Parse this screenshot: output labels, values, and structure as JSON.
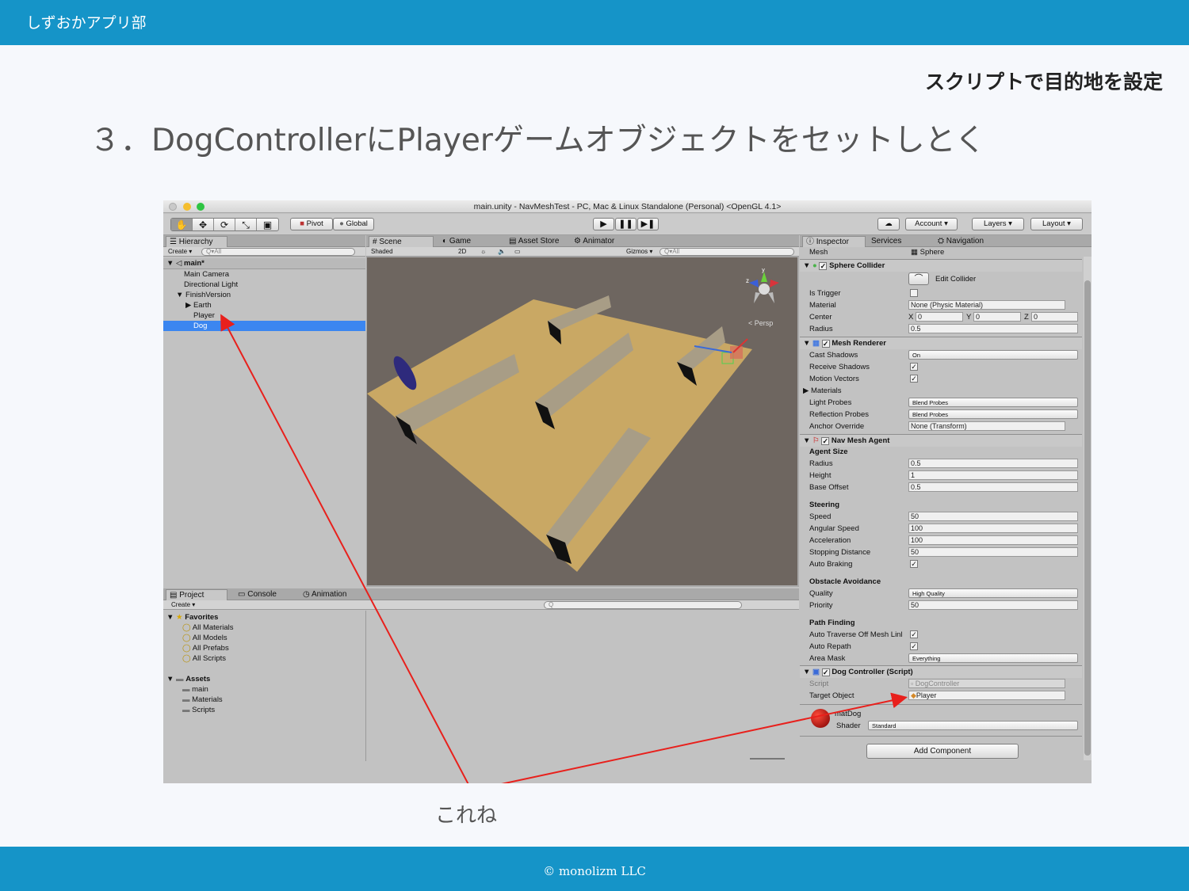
{
  "header": {
    "org": "しずおかアプリ部"
  },
  "footer": {
    "copyright": "© monolizm LLC"
  },
  "slide": {
    "section": "スクリプトで目的地を設定",
    "title": "３．DogControllerにPlayerゲームオブジェクトをセットしとく",
    "note": "これね"
  },
  "colors": {
    "brand": "#1594c8",
    "arrow": "#e8201c",
    "selection": "#3b86f0",
    "ground": "#c9a864"
  },
  "unity": {
    "window_title": "main.unity - NavMeshTest - PC, Mac & Linux Standalone (Personal) <OpenGL 4.1>",
    "toolbar": {
      "tools": [
        "hand-icon",
        "move-icon",
        "rotate-icon",
        "scale-icon",
        "rect-icon"
      ],
      "pivot": "Pivot",
      "global": "Global",
      "play_icons": [
        "play-icon",
        "pause-icon",
        "step-icon"
      ],
      "cloud": "cloud-icon",
      "account": "Account",
      "layers": "Layers",
      "layout": "Layout"
    },
    "hierarchy": {
      "tab": "Hierarchy",
      "create": "Create",
      "search": "Q▾All",
      "scene": "main*",
      "items": [
        "Main Camera",
        "Directional Light",
        "FinishVersion",
        "Earth",
        "Player",
        "Dog"
      ]
    },
    "scene": {
      "tabs": [
        "Scene",
        "Game",
        "Asset Store",
        "Animator"
      ],
      "shaded": "Shaded",
      "mode_2d": "2D",
      "gizmos": "Gizmos",
      "search": "Q▾All",
      "persp": "< Persp"
    },
    "project": {
      "tabs": [
        "Project",
        "Console",
        "Animation"
      ],
      "create": "Create",
      "favorites_label": "Favorites",
      "favorites": [
        "All Materials",
        "All Models",
        "All Prefabs",
        "All Scripts"
      ],
      "assets_label": "Assets",
      "assets": [
        "main",
        "Materials",
        "Scripts"
      ]
    },
    "inspector": {
      "tabs": [
        "Inspector",
        "Services",
        "Navigation"
      ],
      "mesh_label": "Mesh",
      "mesh_value": "Sphere",
      "sphere_collider": {
        "title": "Sphere Collider",
        "edit_collider": "Edit Collider",
        "is_trigger": "Is Trigger",
        "material": "Material",
        "material_value": "None (Physic Material)",
        "center": "Center",
        "x": "0",
        "y": "0",
        "z": "0",
        "radius": "Radius",
        "radius_value": "0.5"
      },
      "mesh_renderer": {
        "title": "Mesh Renderer",
        "cast_shadows": "Cast Shadows",
        "cast_shadows_value": "On",
        "receive_shadows": "Receive Shadows",
        "motion_vectors": "Motion Vectors",
        "materials": "Materials",
        "light_probes": "Light Probes",
        "light_probes_value": "Blend Probes",
        "reflection_probes": "Reflection Probes",
        "reflection_probes_value": "Blend Probes",
        "anchor_override": "Anchor Override",
        "anchor_override_value": "None (Transform)"
      },
      "nav_mesh_agent": {
        "title": "Nav Mesh Agent",
        "agent_size": "Agent Size",
        "radius": "Radius",
        "radius_value": "0.5",
        "height": "Height",
        "height_value": "1",
        "base_offset": "Base Offset",
        "base_offset_value": "0.5",
        "steering": "Steering",
        "speed": "Speed",
        "speed_value": "50",
        "angular_speed": "Angular Speed",
        "angular_speed_value": "100",
        "acceleration": "Acceleration",
        "acceleration_value": "100",
        "stopping_distance": "Stopping Distance",
        "stopping_distance_value": "50",
        "auto_braking": "Auto Braking",
        "obstacle_avoidance": "Obstacle Avoidance",
        "quality": "Quality",
        "quality_value": "High Quality",
        "priority": "Priority",
        "priority_value": "50",
        "path_finding": "Path Finding",
        "auto_traverse": "Auto Traverse Off Mesh Linl",
        "auto_repath": "Auto Repath",
        "area_mask": "Area Mask",
        "area_mask_value": "Everything"
      },
      "dog_controller": {
        "title": "Dog Controller (Script)",
        "script": "Script",
        "script_value": "DogController",
        "target_object": "Target Object",
        "target_object_value": "Player"
      },
      "material": {
        "name": "matDog",
        "shader": "Shader",
        "shader_value": "Standard"
      },
      "add_component": "Add Component"
    }
  }
}
